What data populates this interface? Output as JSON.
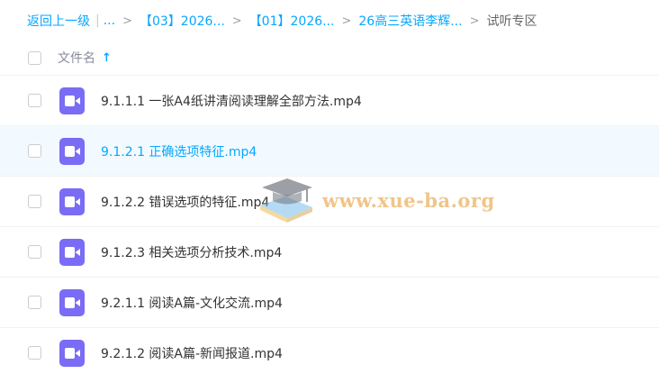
{
  "breadcrumb": {
    "back": "返回上一级",
    "ellipsis": "...",
    "items": [
      "【03】2026...",
      "【01】2026...",
      "26高三英语李辉..."
    ],
    "current": "试听专区",
    "separator": ">",
    "pipe": "|"
  },
  "list_header": {
    "column_label": "文件名",
    "sort_arrow": "↑"
  },
  "files": [
    "9.1.1.1 一张A4纸讲清阅读理解全部方法.mp4",
    "9.1.2.1 正确选项特征.mp4",
    "9.1.2.2 错误选项的特征.mp4",
    "9.1.2.3 相关选项分析技术.mp4",
    "9.2.1.1 阅读A篇-文化交流.mp4",
    "9.2.1.2 阅读A篇-新闻报道.mp4"
  ],
  "watermark": {
    "text": "www.xue-ba.org"
  },
  "colors": {
    "accent": "#06a7ff",
    "video_icon": "#7a6cf5",
    "highlight_row": "#f2faff"
  }
}
